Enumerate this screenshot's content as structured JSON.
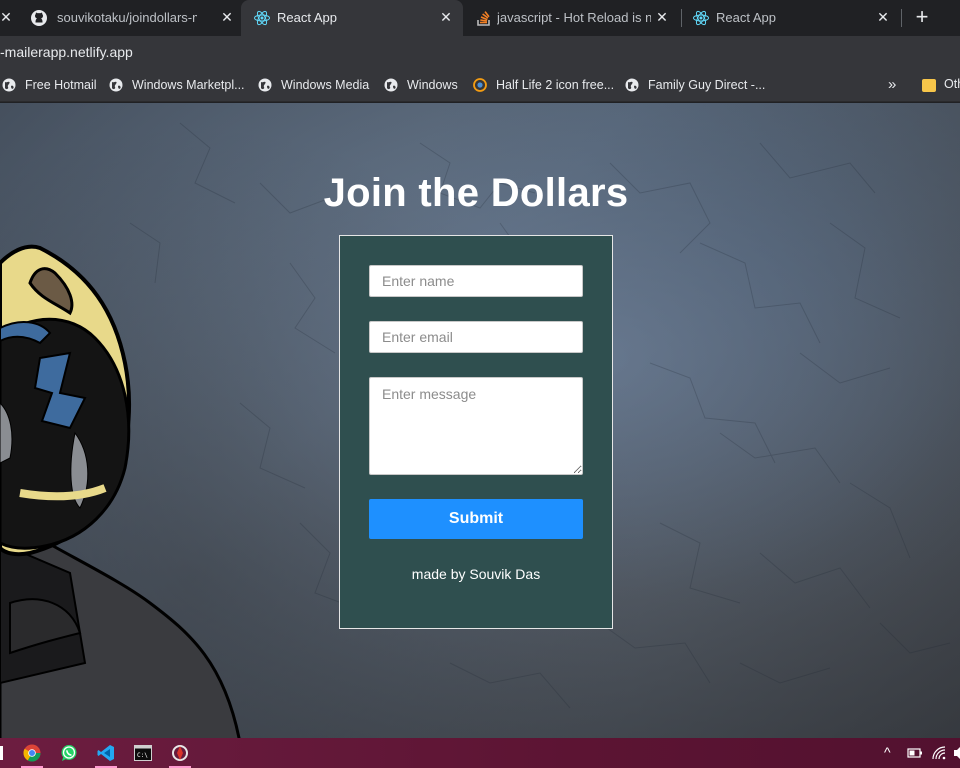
{
  "browser": {
    "tabs": [
      {
        "title": "souvikotaku/joindollars-maile",
        "icon": "github-icon",
        "active": false
      },
      {
        "title": "React App",
        "icon": "react-icon",
        "active": true
      },
      {
        "title": "javascript - Hot Reload is not",
        "icon": "stackoverflow-icon",
        "active": false
      },
      {
        "title": "React App",
        "icon": "react-icon",
        "active": false
      }
    ],
    "close_glyph": "✕",
    "new_tab_glyph": "+",
    "url": "-mailerapp.netlify.app",
    "bookmarks": [
      {
        "label": "Free Hotmail",
        "icon": "globe-icon"
      },
      {
        "label": "Windows Marketpl...",
        "icon": "globe-icon"
      },
      {
        "label": "Windows Media",
        "icon": "globe-icon"
      },
      {
        "label": "Windows",
        "icon": "globe-icon"
      },
      {
        "label": "Half Life 2 icon free...",
        "icon": "halflife-icon"
      },
      {
        "label": "Family Guy Direct -...",
        "icon": "globe-icon"
      }
    ],
    "bookmarks_overflow": "»",
    "other_bookmarks": "Oth"
  },
  "page": {
    "heading": "Join the Dollars",
    "form": {
      "name_placeholder": "Enter name",
      "email_placeholder": "Enter email",
      "message_placeholder": "Enter message",
      "submit_label": "Submit"
    },
    "credit": "made by Souvik Das"
  },
  "taskbar": {
    "apps": [
      "chrome-icon",
      "whatsapp-icon",
      "vscode-icon",
      "terminal-icon",
      "app-icon"
    ],
    "tray_up": "^"
  },
  "colors": {
    "card_bg": "#2f4f4f",
    "submit_bg": "#1e90ff",
    "taskbar": "#5c1433"
  }
}
